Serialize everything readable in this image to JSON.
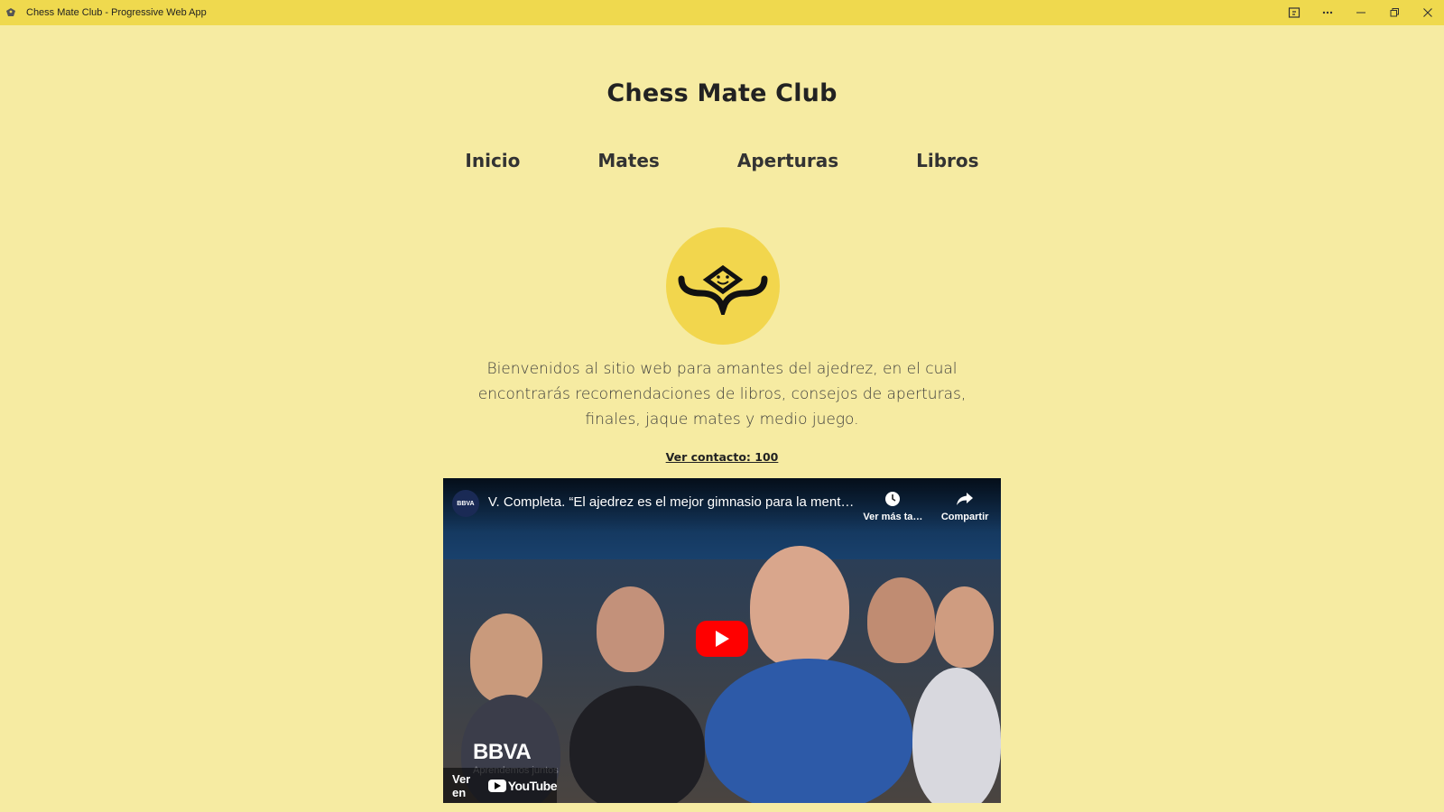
{
  "window": {
    "title": "Chess Mate Club - Progressive Web App",
    "titlebar_color": "#efd94e",
    "background_color": "#f6eba2"
  },
  "site": {
    "title": "Chess Mate Club",
    "nav": [
      "Inicio",
      "Mates",
      "Aperturas",
      "Libros"
    ],
    "welcome": "Bienvenidos al sitio web para amantes del ajedrez, en el cual encontrarás recomendaciones de libros, consejos de aperturas, finales, jaque mates y medio juego.",
    "contact_link": "Ver contacto: 100",
    "logo_color": "#f2d64d"
  },
  "video": {
    "title": "V. Completa. “El ajedrez es el mejor gimnasio para la ment…",
    "channel_avatar": "BBVA",
    "watch_later": "Ver más ta…",
    "share": "Compartir",
    "brand": "BBVA",
    "brand_sub": "Aprendemos juntos",
    "watch_on": "Ver en",
    "youtube": "YouTube",
    "play_color": "#ff0000"
  }
}
